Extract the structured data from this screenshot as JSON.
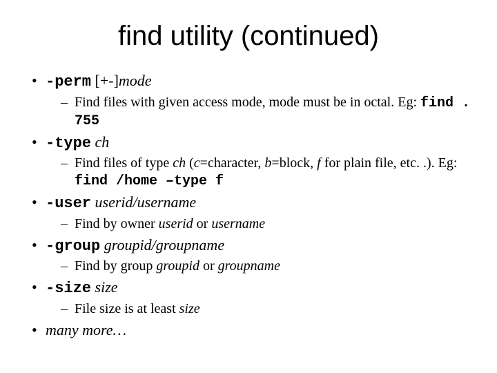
{
  "title": "find utility (continued)",
  "items": [
    {
      "head": {
        "cmd": "-perm",
        "tail_plain": " [+-]",
        "tail_ital": "mode"
      },
      "sub": {
        "pre": "Find files with given access mode, mode must be in octal.  Eg: ",
        "eg": "find . 755"
      }
    },
    {
      "head": {
        "cmd": "-type",
        "tail_plain": " ",
        "tail_ital": "ch"
      },
      "sub": {
        "pre": "Find files of type ",
        "i1": "ch",
        "mid1": " (",
        "i2": "c",
        "mid2": "=character, ",
        "i3": "b",
        "mid3": "=block, ",
        "i4": "f",
        "mid4": " for plain file, etc. .). Eg: ",
        "eg": "find /home –type f"
      }
    },
    {
      "head": {
        "cmd": "-user",
        "tail_plain": " ",
        "tail_ital": "userid/username"
      },
      "sub": {
        "pre": "Find by owner ",
        "i1": "userid",
        "mid1": " or ",
        "i2": "username"
      }
    },
    {
      "head": {
        "cmd": "-group",
        "tail_plain": " ",
        "tail_ital": "groupid/groupname"
      },
      "sub": {
        "pre": "Find by group ",
        "i1": "groupid",
        "mid1": " or ",
        "i2": "groupname"
      }
    },
    {
      "head": {
        "cmd": "-size",
        "tail_plain": " ",
        "tail_ital": "size"
      },
      "sub": {
        "pre": "File size is at least ",
        "i1": "size"
      }
    },
    {
      "head_ital_only": "many more…"
    }
  ]
}
